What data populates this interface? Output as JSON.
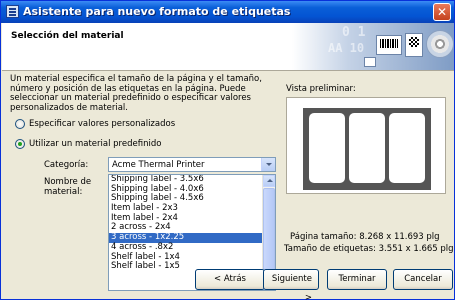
{
  "window": {
    "title": "Asistente para nuevo formato de etiquetas",
    "close_label": "✕"
  },
  "header": {
    "title": "Selección del material",
    "art_text_1": "0 1",
    "art_text_2": "AA 10"
  },
  "description": "Un material especifica el tamaño de la página y el tamaño, número y posición de las etiquetas en la página. Puede seleccionar un material predefinido o especificar valores personalizados de material.",
  "options": {
    "custom_label": "Especificar valores personalizados",
    "predefined_label": "Utilizar un material predefinido",
    "selected": "predefined"
  },
  "category": {
    "label": "Categoría:",
    "value": "Acme Thermal Printer"
  },
  "material": {
    "label": "Nombre de material:",
    "items": [
      "Shipping label - 3.5x6",
      "Shipping label - 4.0x6",
      "Shipping label - 4.5x6",
      "Item label - 2x3",
      "Item label - 2x4",
      "2 across - 2x4",
      "3 across - 1x2.25",
      "4 across - .8x2",
      "Shelf label - 1x4",
      "Shelf label - 1x5"
    ],
    "selected_index": 6
  },
  "preview": {
    "label": "Vista preliminar:",
    "columns": 3,
    "page_size_label": "Página tamaño:",
    "page_size_value": "8.268 x 11.693 plg",
    "label_size_label": "Tamaño de etiquetas:",
    "label_size_value": "3.551 x 1.665 plg"
  },
  "buttons": {
    "back": "< Atrás",
    "next": "Siguiente >",
    "finish": "Terminar",
    "cancel": "Cancelar"
  },
  "colors": {
    "titlebar": "#0454d3",
    "selection": "#316ac5",
    "dialog_bg": "#ece9d8"
  }
}
